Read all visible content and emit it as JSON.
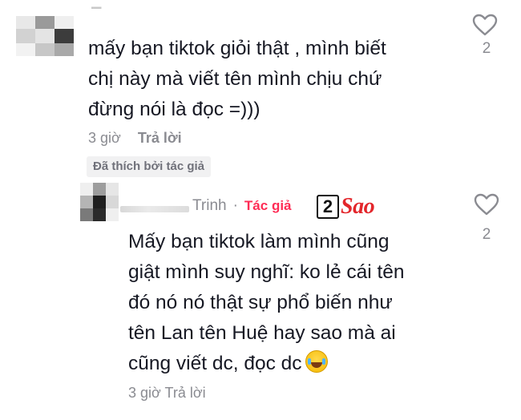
{
  "comments": [
    {
      "username": "",
      "text_lines": [
        "mấy bạn tiktok giỏi thật , mình biết",
        "chị này mà viết tên mình chịu chứ",
        "đừng nói là đọc =)))"
      ],
      "time": "3 giờ",
      "reply_label": "Trả lời",
      "liked_by_author_label": "Đã thích bởi tác giả",
      "like_count": "2",
      "icons": [
        "avatar-blurred",
        "heart-outline-icon"
      ]
    },
    {
      "username": "Trinh",
      "separator": "·",
      "author_badge": "Tác giả",
      "text_lines": [
        "Mấy bạn tiktok làm mình cũng",
        "giật mình suy nghĩ: ko lẻ cái tên",
        "đó nó nó thật sự phổ biến như",
        "tên Lan tên Huệ hay sao mà ai",
        "cũng viết dc, đọc dc"
      ],
      "emoji": "joy-emoji",
      "time": "3 giờ",
      "reply_label": "Trả lời",
      "like_count": "2",
      "icons": [
        "avatar-blurred",
        "heart-outline-icon"
      ]
    }
  ],
  "watermark": {
    "number": "2",
    "text": "Sao"
  },
  "colors": {
    "text": "#161823",
    "meta": "#8a8b91",
    "author_badge": "#fe2c55",
    "watermark_red": "#e3262b",
    "badge_bg": "#f1f1f2"
  }
}
